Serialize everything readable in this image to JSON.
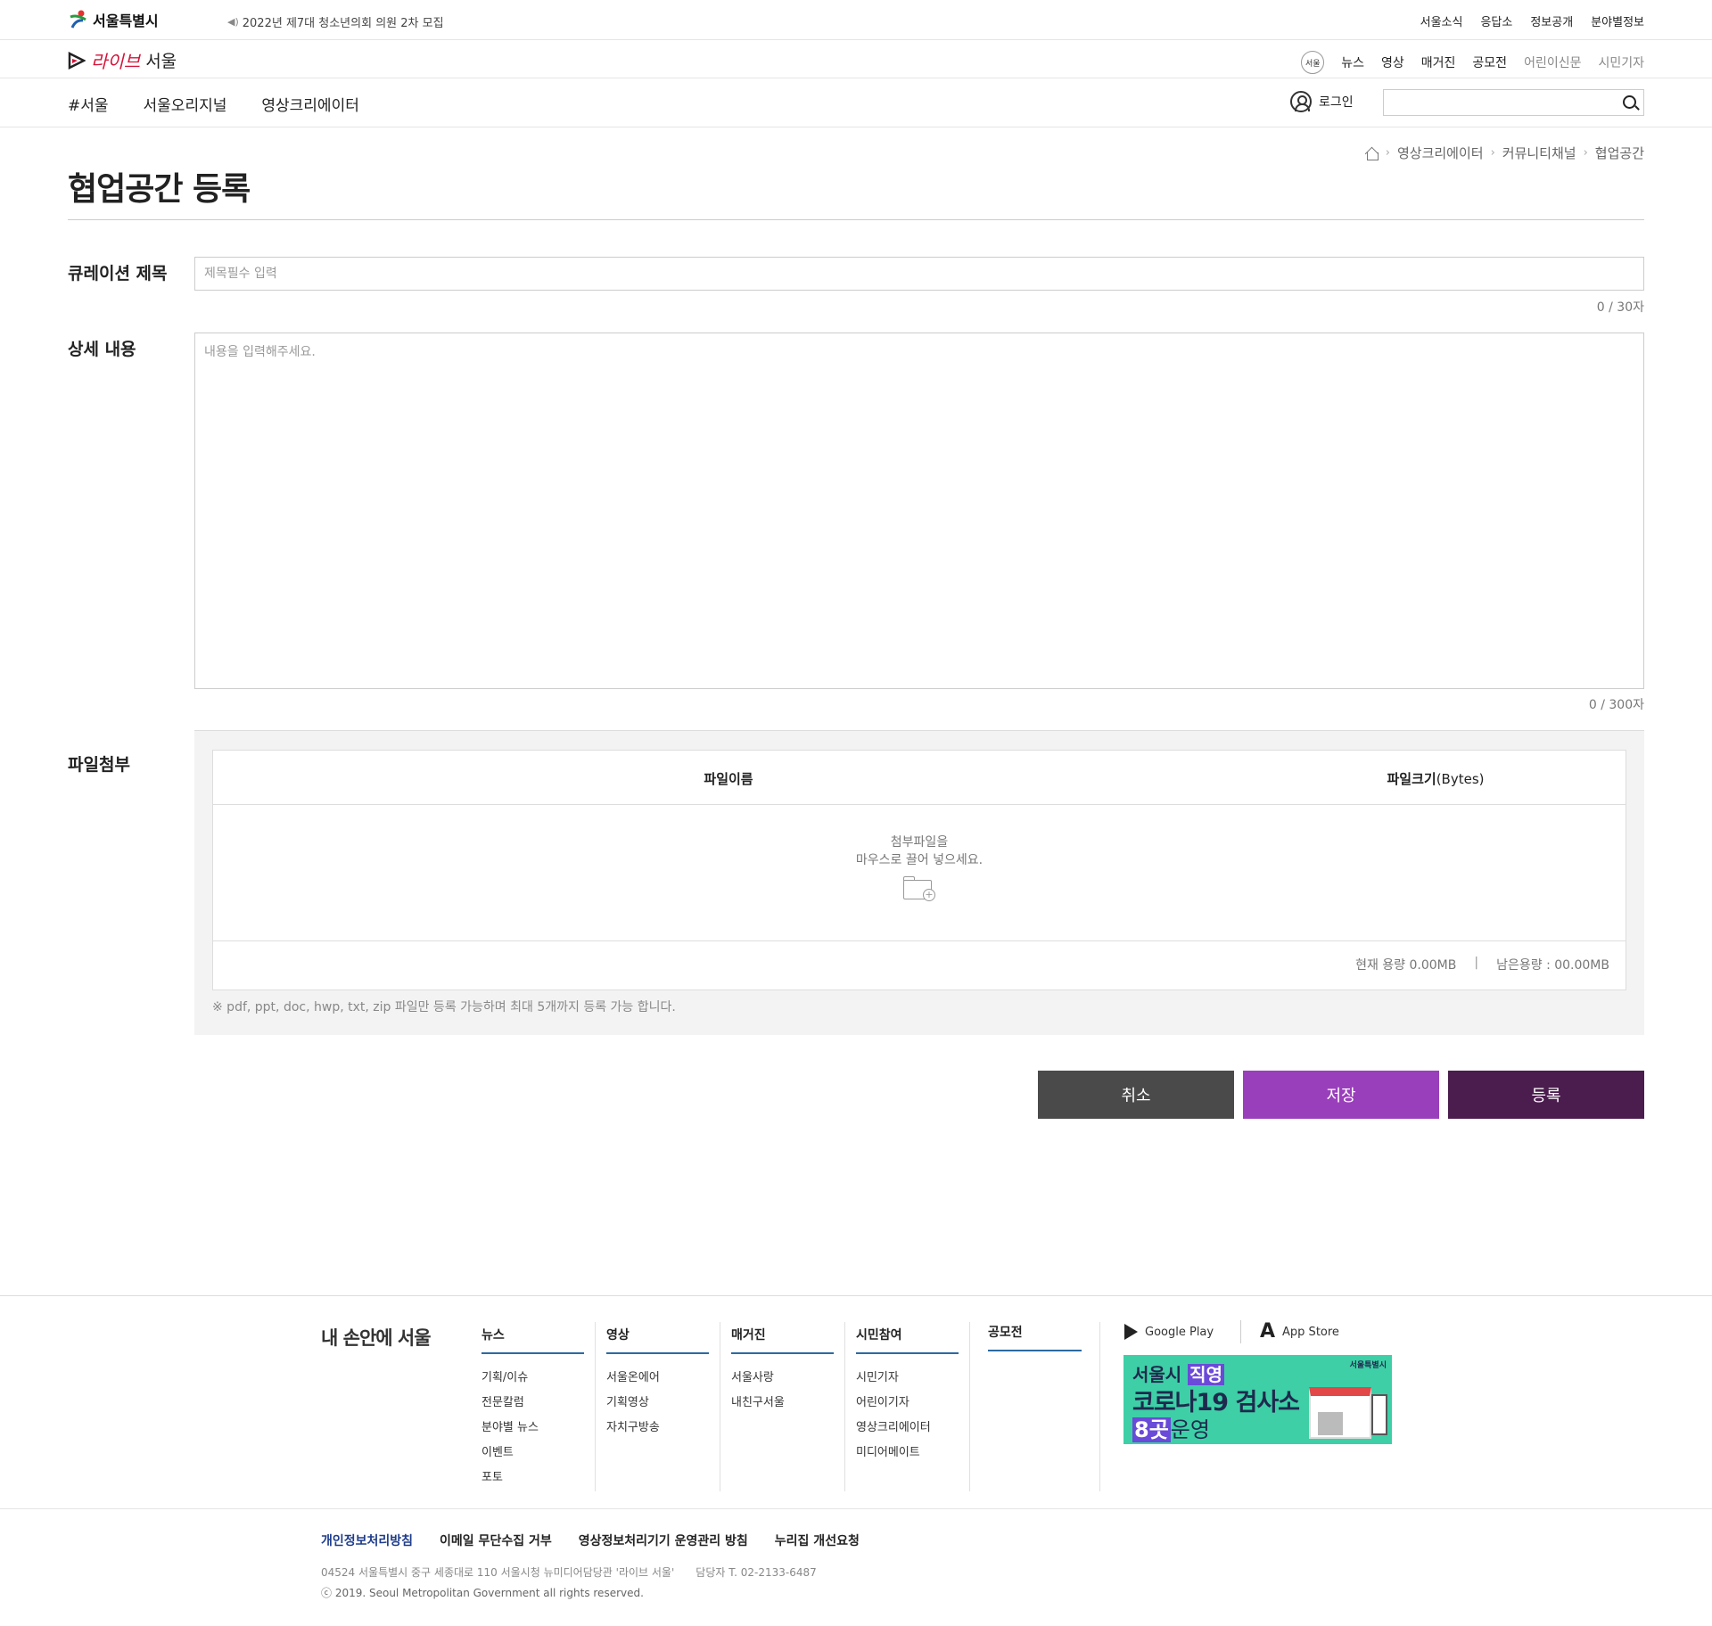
{
  "topbar": {
    "brand": "서울특별시",
    "notice": "2022년 제7대 청소년의회 의원 2차 모집",
    "links": [
      "서울소식",
      "응답소",
      "정보공개",
      "분야별정보"
    ]
  },
  "subbar": {
    "brand_script": "라이브",
    "brand_text": "서울",
    "round_logo": "서울",
    "links": [
      "뉴스",
      "영상",
      "매거진",
      "공모전"
    ],
    "muted_links": [
      "어린이신문",
      "시민기자"
    ]
  },
  "mainnav": {
    "tabs": [
      "#서울",
      "서울오리지널",
      "영상크리에이터"
    ],
    "login": "로그인",
    "search_placeholder": ""
  },
  "breadcrumb": [
    "영상크리에이터",
    "커뮤니티채널",
    "협업공간"
  ],
  "page_title": "협업공간 등록",
  "form": {
    "title_label": "큐레이션 제목",
    "title_placeholder": "제목필수 입력",
    "title_counter": "0 / 30자",
    "detail_label": "상세 내용",
    "detail_placeholder": "내용을 입력해주세요.",
    "detail_counter": "0 / 300자",
    "file_label": "파일첨부",
    "file_col_name": "파일이름",
    "file_col_size_label": "파일크기",
    "file_col_size_unit": "(Bytes)",
    "drop_line1": "첨부파일을",
    "drop_line2": "마우스로 끌어 넣으세요.",
    "current_capacity": "현재 용량 0.00MB",
    "remaining_capacity": "남은용량 : 00.00MB",
    "note": "※ pdf, ppt, doc, hwp, txt, zip 파일만 등록 가능하며 최대 5개까지 등록 가능 합니다."
  },
  "buttons": {
    "cancel": "취소",
    "save": "저장",
    "register": "등록"
  },
  "colors": {
    "cancel": "#4a4a4a",
    "save": "#9a3fbb",
    "register": "#4b1c4e"
  },
  "footer": {
    "brand": "내 손안에 서울",
    "columns": [
      {
        "head": "뉴스",
        "items": [
          "기획/이슈",
          "전문칼럼",
          "분야별 뉴스",
          "이벤트",
          "포토"
        ]
      },
      {
        "head": "영상",
        "items": [
          "서울온에어",
          "기획영상",
          "자치구방송"
        ]
      },
      {
        "head": "매거진",
        "items": [
          "서울사랑",
          "내친구서울"
        ]
      },
      {
        "head": "시민참여",
        "items": [
          "시민기자",
          "어린이기자",
          "영상크리에이터",
          "미디어메이트"
        ]
      },
      {
        "head": "공모전",
        "items": []
      }
    ],
    "google_play": "Google Play",
    "app_store": "App Store",
    "banner": {
      "line1_a": "서울시 ",
      "line1_b": "직영",
      "line2": "코로나19 검사소",
      "line3_a": "8곳",
      "line3_b": "운영",
      "org": "서울특별시"
    },
    "policy_links": [
      "개인정보처리방침",
      "이메일 무단수집 거부",
      "영상정보처리기기 운영관리 방침",
      "누리집 개선요청"
    ],
    "address": "04524 서울특별시 중구 세종대로 110 서울시청 뉴미디어담당관 '라이브 서울'",
    "contact": "담당자 T. 02-2133-6487",
    "copyright": "ⓒ 2019. Seoul Metropolitan Government all rights reserved."
  }
}
